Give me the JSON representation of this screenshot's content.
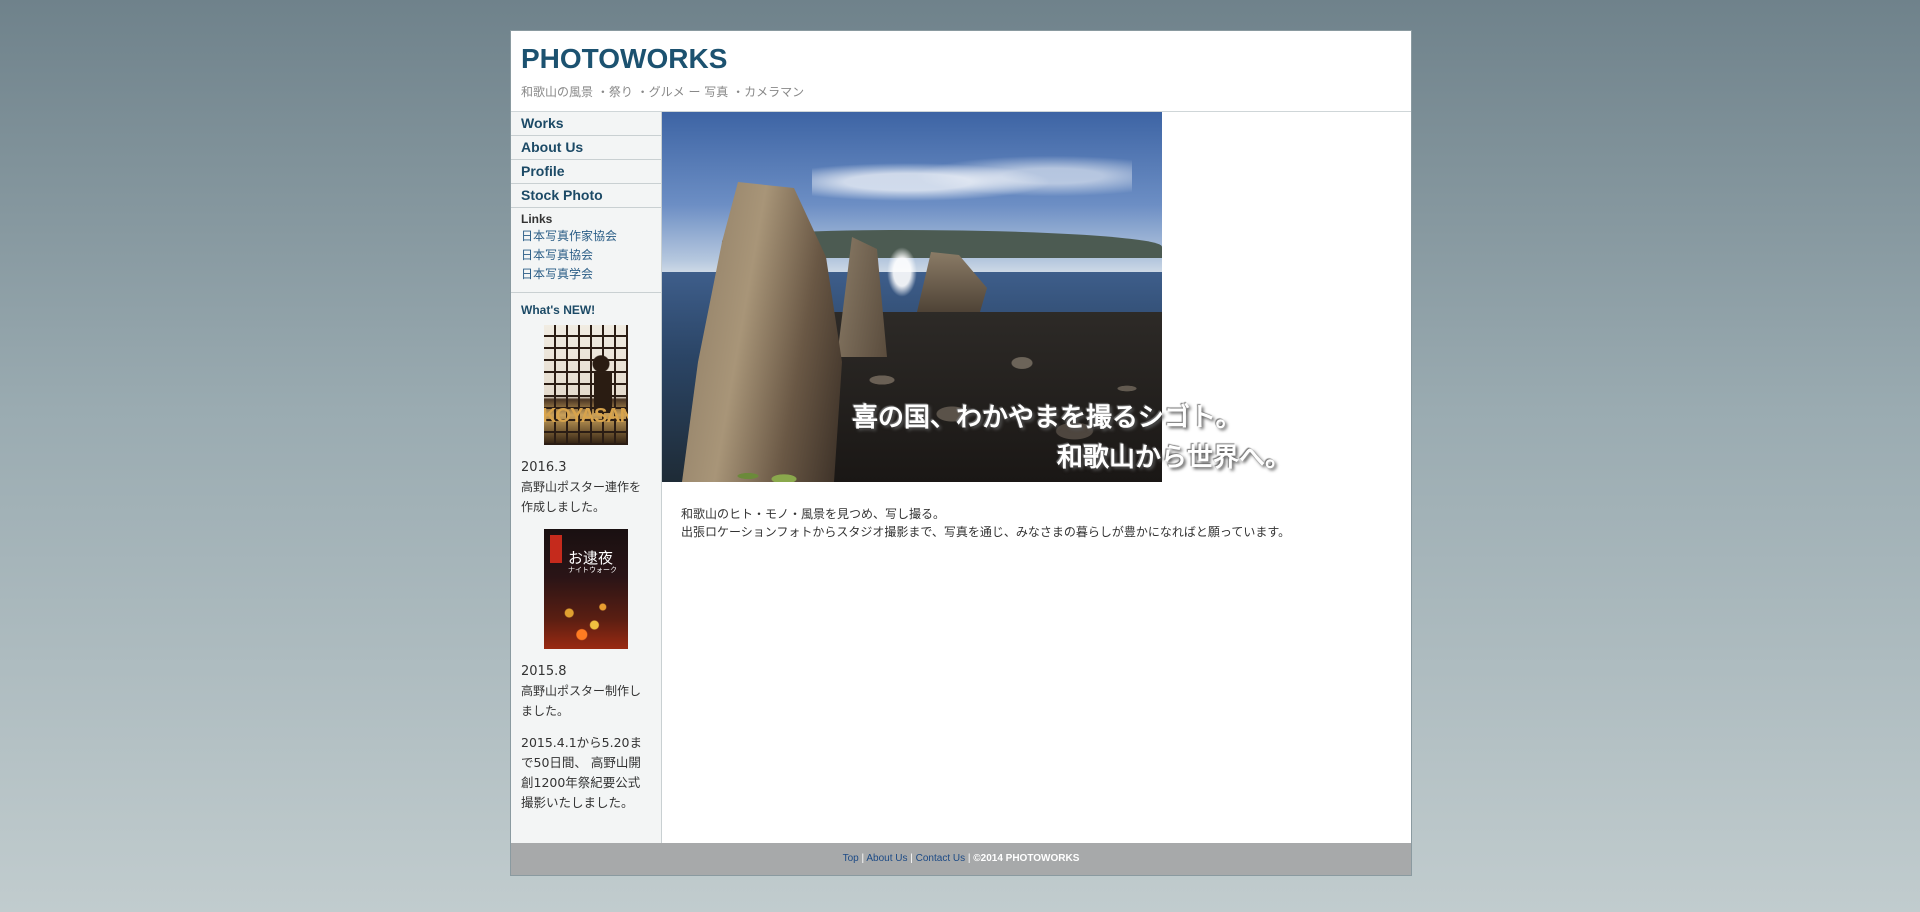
{
  "header": {
    "logo": "PHOTOWORKS",
    "tagline": "和歌山の風景 ・祭り ・グルメ ー 写真 ・カメラマン"
  },
  "nav": {
    "items": [
      {
        "label": "Works"
      },
      {
        "label": "About Us"
      },
      {
        "label": "Profile"
      },
      {
        "label": "Stock Photo"
      }
    ]
  },
  "links": {
    "title": "Links",
    "items": [
      {
        "label": "日本写真作家協会"
      },
      {
        "label": "日本写真協会"
      },
      {
        "label": "日本写真学会"
      }
    ]
  },
  "news": {
    "title": "What's NEW!",
    "entries": [
      {
        "thumb_text": "KOYASAN",
        "date": "2016.3",
        "text": "高野山ポスター連作を作成しました。"
      },
      {
        "thumb_text": "お逮夜",
        "thumb_sub": "ナイトウォーク",
        "date": "2015.8",
        "text": "高野山ポスター制作しました。"
      }
    ],
    "extra": "2015.4.1から5.20まで50日間、 高野山開創1200年祭紀要公式撮影いたしました。"
  },
  "hero": {
    "slogan_line1": "喜の国、わかやまを撮るシゴト。",
    "slogan_line2": "和歌山から世界へ。"
  },
  "intro": {
    "line1": "和歌山のヒト・モノ・風景を見つめ、写し撮る。",
    "line2": "出張ロケーションフォトからスタジオ撮影まで、写真を通じ、みなさまの暮らしが豊かになればと願っています。"
  },
  "footer": {
    "links": [
      "Top",
      "About Us",
      "Contact Us"
    ],
    "copyright": "©2014 PHOTOWORKS"
  }
}
